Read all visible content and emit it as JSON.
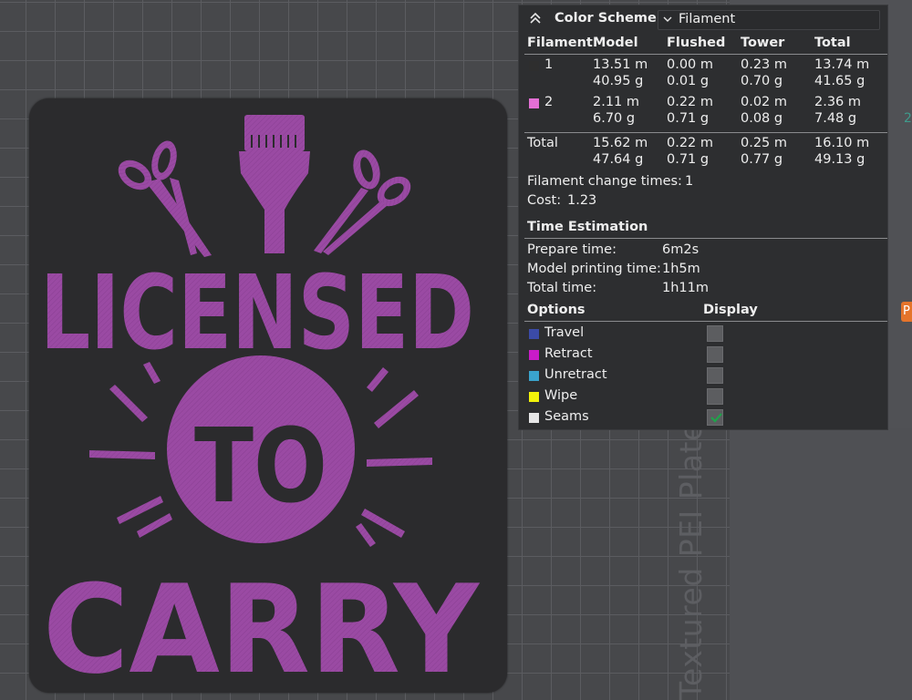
{
  "viewport": {
    "plate_label": "Textured PEI Plate",
    "plate_artwork": {
      "line1": "LICENSED",
      "line2": "TO",
      "line3": "CARRY",
      "color": "#9a4aa3"
    },
    "right_tab_label": "P"
  },
  "panel": {
    "title": "Color Scheme",
    "scheme_value": "Filament",
    "headers": [
      "Filament",
      "Model",
      "Flushed",
      "Tower",
      "Total"
    ],
    "rows": [
      {
        "id": "1",
        "color": "#2e2e2e",
        "model": [
          "13.51 m",
          "40.95 g"
        ],
        "flushed": [
          "0.00 m",
          "0.01 g"
        ],
        "tower": [
          "0.23 m",
          "0.70 g"
        ],
        "total": [
          "13.74 m",
          "41.65 g"
        ]
      },
      {
        "id": "2",
        "color": "#e36fd4",
        "model": [
          "2.11 m",
          "6.70 g"
        ],
        "flushed": [
          "0.22 m",
          "0.71 g"
        ],
        "tower": [
          "0.02 m",
          "0.08 g"
        ],
        "total": [
          "2.36 m",
          "7.48 g"
        ]
      }
    ],
    "total_row": {
      "label": "Total",
      "model": [
        "15.62 m",
        "47.64 g"
      ],
      "flushed": [
        "0.22 m",
        "0.71 g"
      ],
      "tower": [
        "0.25 m",
        "0.77 g"
      ],
      "total": [
        "16.10 m",
        "49.13 g"
      ]
    },
    "filament_change_label": "Filament change times:",
    "filament_change_value": "1",
    "cost_label": "Cost:",
    "cost_value": "1.23",
    "time_estimation": {
      "title": "Time Estimation",
      "items": [
        {
          "label": "Prepare time:",
          "value": "6m2s"
        },
        {
          "label": "Model printing time:",
          "value": "1h5m"
        },
        {
          "label": "Total time:",
          "value": "1h11m"
        }
      ]
    },
    "options": {
      "title": "Options",
      "display_header": "Display",
      "items": [
        {
          "label": "Travel",
          "color": "#3b4ba8",
          "checked": false
        },
        {
          "label": "Retract",
          "color": "#c91bc9",
          "checked": false
        },
        {
          "label": "Unretract",
          "color": "#3aa3cc",
          "checked": false
        },
        {
          "label": "Wipe",
          "color": "#f2f20a",
          "checked": false
        },
        {
          "label": "Seams",
          "color": "#e6e6e6",
          "checked": true
        }
      ]
    }
  }
}
